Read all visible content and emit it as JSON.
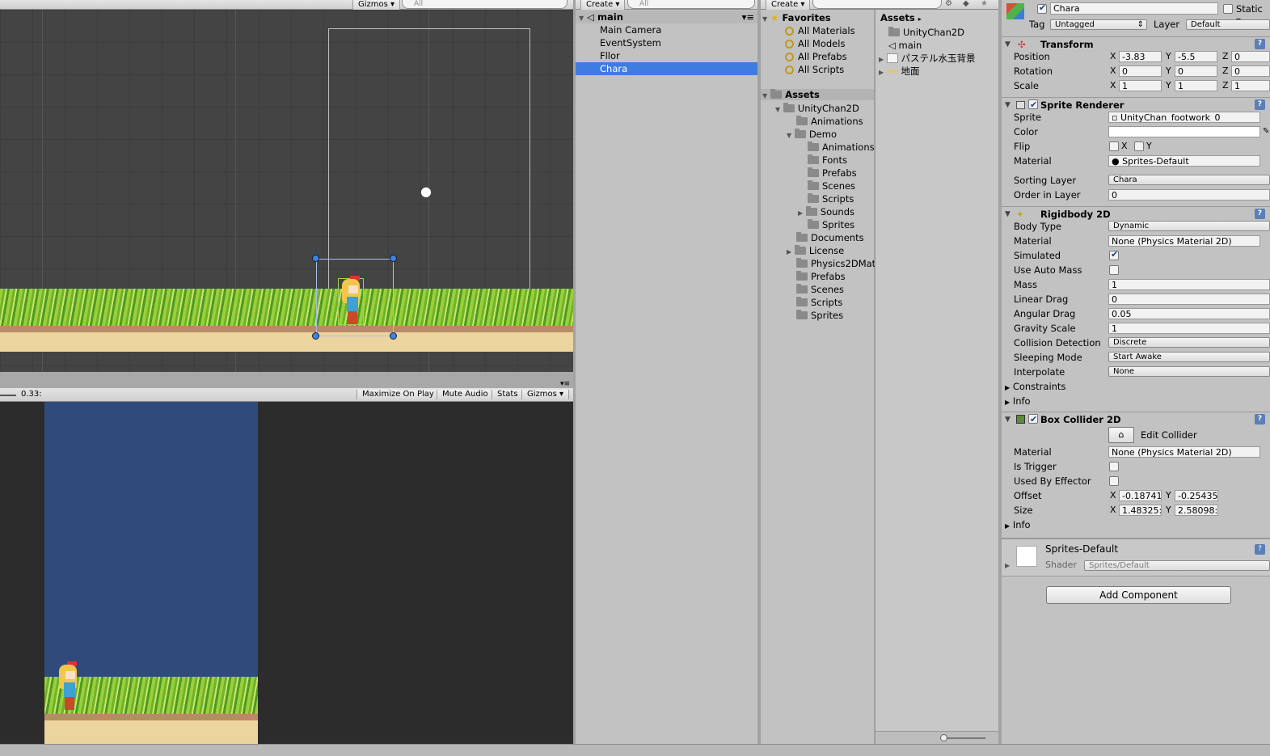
{
  "scene": {
    "gizmos": "Gizmos",
    "search": "All"
  },
  "game": {
    "time": "0.33:",
    "buttons": [
      "Maximize On Play",
      "Mute Audio",
      "Stats",
      "Gizmos"
    ]
  },
  "hierarchy": {
    "create": "Create",
    "search": "All",
    "scene": "main",
    "items": [
      "Main Camera",
      "EventSystem",
      "Fllor",
      "Chara"
    ],
    "selected": "Chara"
  },
  "project": {
    "create": "Create",
    "favorites_label": "Favorites",
    "favorites": [
      "All Materials",
      "All Models",
      "All Prefabs",
      "All Scripts"
    ],
    "assets_label": "Assets",
    "tree": [
      "UnityChan2D",
      "Animations",
      "Demo",
      "Animations",
      "Fonts",
      "Prefabs",
      "Scenes",
      "Scripts",
      "Sounds",
      "Sprites",
      "Documents",
      "License",
      "Physics2DMat",
      "Prefabs",
      "Scenes",
      "Scripts",
      "Sprites"
    ],
    "right_header": "Assets",
    "right_items": [
      "UnityChan2D",
      "main",
      "パステル水玉背景",
      "地面"
    ]
  },
  "inspector": {
    "name": "Chara",
    "static_label": "Static",
    "tag_label": "Tag",
    "tag": "Untagged",
    "layer_label": "Layer",
    "layer": "Default",
    "transform": {
      "title": "Transform",
      "position_label": "Position",
      "position": {
        "x": "-3.83",
        "y": "-5.5",
        "z": "0"
      },
      "rotation_label": "Rotation",
      "rotation": {
        "x": "0",
        "y": "0",
        "z": "0"
      },
      "scale_label": "Scale",
      "scale": {
        "x": "1",
        "y": "1",
        "z": "1"
      }
    },
    "sprite_renderer": {
      "title": "Sprite Renderer",
      "sprite_label": "Sprite",
      "sprite": "UnityChan_footwork_0",
      "color_label": "Color",
      "flip_label": "Flip",
      "flip_x": "X",
      "flip_y": "Y",
      "material_label": "Material",
      "material": "Sprites-Default",
      "sorting_layer_label": "Sorting Layer",
      "sorting_layer": "Chara",
      "order_label": "Order in Layer",
      "order": "0"
    },
    "rigidbody": {
      "title": "Rigidbody 2D",
      "body_type_label": "Body Type",
      "body_type": "Dynamic",
      "material_label": "Material",
      "material": "None (Physics Material 2D)",
      "simulated_label": "Simulated",
      "auto_mass_label": "Use Auto Mass",
      "mass_label": "Mass",
      "mass": "1",
      "linear_drag_label": "Linear Drag",
      "linear_drag": "0",
      "angular_drag_label": "Angular Drag",
      "angular_drag": "0.05",
      "gravity_label": "Gravity Scale",
      "gravity": "1",
      "collision_label": "Collision Detection",
      "collision": "Discrete",
      "sleeping_label": "Sleeping Mode",
      "sleeping": "Start Awake",
      "interpolate_label": "Interpolate",
      "interpolate": "None",
      "constraints_label": "Constraints",
      "info_label": "Info"
    },
    "box_collider": {
      "title": "Box Collider 2D",
      "edit_label": "Edit Collider",
      "material_label": "Material",
      "material": "None (Physics Material 2D)",
      "trigger_label": "Is Trigger",
      "effector_label": "Used By Effector",
      "offset_label": "Offset",
      "offset": {
        "x": "-0.18741",
        "y": "-0.25435"
      },
      "size_label": "Size",
      "size": {
        "x": "1.48325:",
        "y": "2.58098:"
      },
      "info_label": "Info"
    },
    "material_preview": {
      "name": "Sprites-Default",
      "shader_label": "Shader",
      "shader": "Sprites/Default"
    },
    "add_component": "Add Component"
  }
}
